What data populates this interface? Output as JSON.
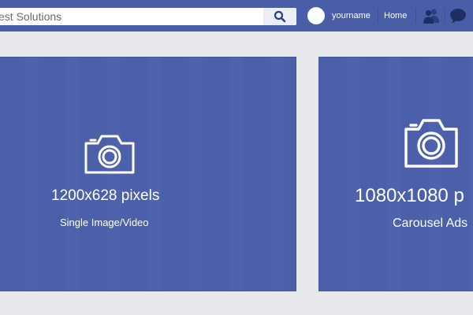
{
  "header": {
    "search_text": "est Solutions",
    "username": "yourname",
    "nav_home": "Home",
    "icons": [
      "search-icon",
      "avatar",
      "friends-icon",
      "chat-icon"
    ],
    "colors": {
      "bar": "#4a5ea8",
      "search_bg": "#ffffff",
      "text": "#ffffff"
    }
  },
  "cards": [
    {
      "dimensions": "1200x628 pixels",
      "format": "Single Image/Video",
      "icon": "camera-icon"
    },
    {
      "dimensions": "1080x1080 p",
      "format": "Carousel Ads",
      "icon": "camera-icon"
    }
  ],
  "colors": {
    "page_bg": "#e6e8eb",
    "card_bg": "#4c5fa9"
  }
}
